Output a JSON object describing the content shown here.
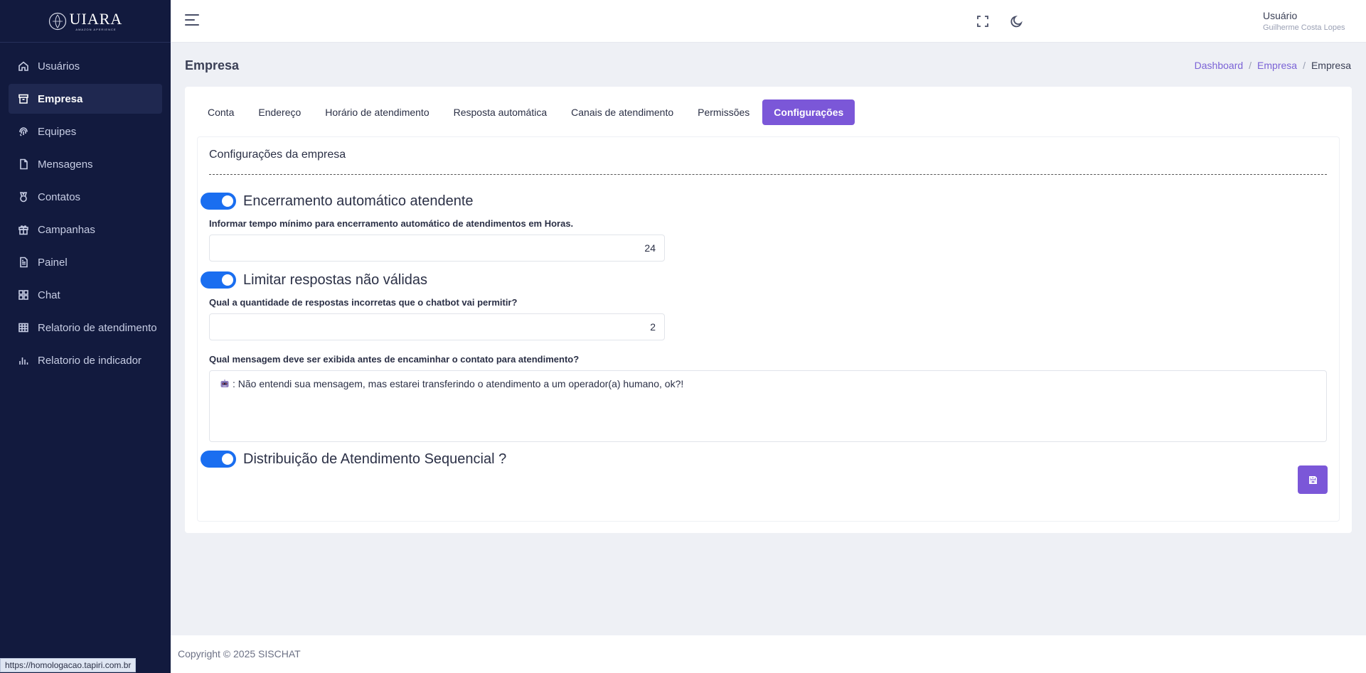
{
  "brand": {
    "name": "UIARA",
    "tagline": "AMAZON APERIENCE"
  },
  "sidebar": {
    "items": [
      {
        "label": "Usuários",
        "icon": "home-icon"
      },
      {
        "label": "Empresa",
        "icon": "archive-icon",
        "active": true
      },
      {
        "label": "Equipes",
        "icon": "fingerprint-icon"
      },
      {
        "label": "Mensagens",
        "icon": "file-icon"
      },
      {
        "label": "Contatos",
        "icon": "medal-icon"
      },
      {
        "label": "Campanhas",
        "icon": "gift-icon"
      },
      {
        "label": "Painel",
        "icon": "file-text-icon"
      },
      {
        "label": "Chat",
        "icon": "grid-icon"
      },
      {
        "label": "Relatorio de atendimento",
        "icon": "table-icon"
      },
      {
        "label": "Relatorio de indicador",
        "icon": "bar-chart-icon"
      }
    ]
  },
  "topbar": {
    "user_title": "Usuário",
    "user_name": "Guilherme Costa Lopes"
  },
  "page": {
    "title": "Empresa",
    "breadcrumb": {
      "item1": "Dashboard",
      "item2": "Empresa",
      "current": "Empresa"
    }
  },
  "tabs": [
    {
      "label": "Conta"
    },
    {
      "label": "Endereço"
    },
    {
      "label": "Horário de atendimento"
    },
    {
      "label": "Resposta automática"
    },
    {
      "label": "Canais de atendimento"
    },
    {
      "label": "Permissões"
    },
    {
      "label": "Configurações",
      "active": true
    }
  ],
  "settings": {
    "section_title": "Configurações da empresa",
    "auto_close": {
      "label": "Encerramento automático atendente",
      "field_label": "Informar tempo mínimo para encerramento automático de atendimentos em Horas.",
      "value": "24"
    },
    "limit_invalid": {
      "label": "Limitar respostas não válidas",
      "field_label": "Qual a quantidade de respostas incorretas que o chatbot vai permitir?",
      "value": "2"
    },
    "message": {
      "field_label": "Qual mensagem deve ser exibida antes de encaminhar o contato para atendimento?",
      "value": ": Não entendi sua mensagem, mas estarei transferindo o atendimento a um operador(a) humano, ok?!"
    },
    "sequential": {
      "label": "Distribuição de Atendimento Sequencial ?"
    }
  },
  "footer": {
    "copyright": "Copyright © 2025 SISCHAT"
  },
  "status_bar": {
    "url": "https://homologacao.tapiri.com.br"
  },
  "colors": {
    "sidebar": "#121a3e",
    "accent": "#7b57d8",
    "toggle": "#1a6ef0",
    "link": "#7b63d6"
  }
}
